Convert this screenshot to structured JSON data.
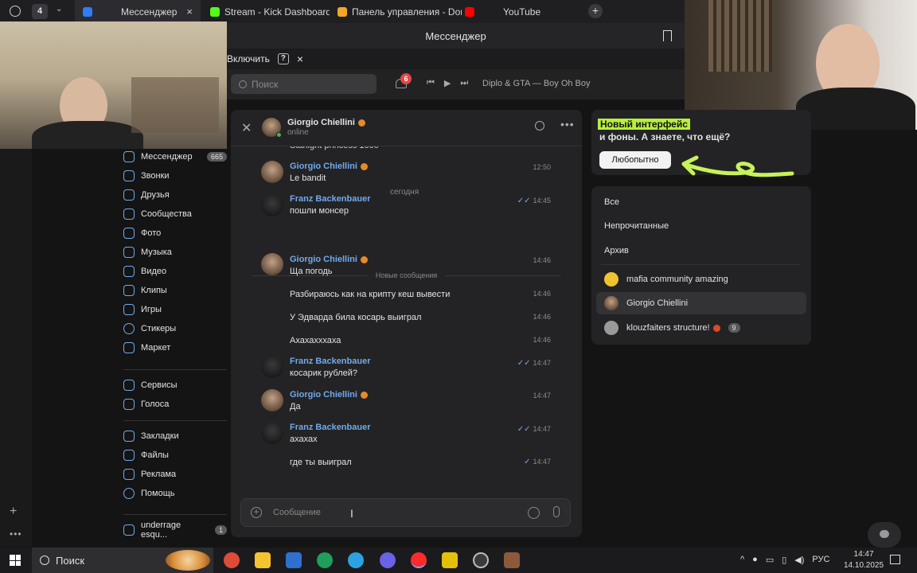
{
  "browser": {
    "tab_count": "4",
    "tabs": [
      {
        "label": "Мессенджер",
        "color": "#2f7cf6"
      },
      {
        "label": "Stream - Kick Dashboard",
        "color": "#53fc18"
      },
      {
        "label": "Панель управления - Don",
        "color": "#f5a623"
      },
      {
        "label": "YouTube",
        "color": "#ff0000"
      }
    ],
    "title": "Мессенджер",
    "infobar_enable": "Включить",
    "infobar_help": "?",
    "infobar_close": "×"
  },
  "vk_header": {
    "search_placeholder": "Поиск",
    "notifications_count": "6",
    "track": "Diplo & GTA — Boy Oh Boy"
  },
  "nav": {
    "items": [
      {
        "label": "Мессенджер",
        "count": "665"
      },
      {
        "label": "Звонки"
      },
      {
        "label": "Друзья"
      },
      {
        "label": "Сообщества"
      },
      {
        "label": "Фото"
      },
      {
        "label": "Музыка"
      },
      {
        "label": "Видео"
      },
      {
        "label": "Клипы"
      },
      {
        "label": "Игры"
      },
      {
        "label": "Стикеры"
      },
      {
        "label": "Маркет"
      }
    ],
    "services": [
      {
        "label": "Сервисы"
      },
      {
        "label": "Голоса"
      }
    ],
    "extras": [
      {
        "label": "Закладки"
      },
      {
        "label": "Файлы"
      },
      {
        "label": "Реклама"
      },
      {
        "label": "Помощь"
      }
    ],
    "group": {
      "label": "underrage esqu...",
      "count": "1"
    }
  },
  "chat": {
    "peer_name": "Giorgio Chiellini",
    "peer_status": "online",
    "cut_text": "Starlight princess 1000",
    "date_divider": "сегодня",
    "new_divider": "Новые сообщения",
    "messages": [
      {
        "name": "Giorgio Chiellini",
        "text": "Le bandit",
        "time": "12:50"
      },
      {
        "name": "Franz Backenbauer",
        "text": "пошли монсер",
        "time": "14:45",
        "read": true
      },
      {
        "name": "Giorgio Chiellini",
        "text": "Ща погодь",
        "time": "14:46"
      },
      {
        "text": "Разбираюсь как на крипту кеш вывести",
        "time": "14:46"
      },
      {
        "text": "У Эдварда била косарь выиграл",
        "time": "14:46"
      },
      {
        "text": "Ахахахххаха",
        "time": "14:46"
      },
      {
        "name": "Franz Backenbauer",
        "text": "косарик рублей?",
        "time": "14:47",
        "read": true
      },
      {
        "name": "Giorgio Chiellini",
        "text": "Да",
        "time": "14:47"
      },
      {
        "name": "Franz Backenbauer",
        "text": "ахахах",
        "time": "14:47",
        "read": true
      },
      {
        "text": "где ты выиграл",
        "time": "14:47",
        "read": true
      }
    ],
    "composer_placeholder": "Сообщение"
  },
  "promo": {
    "highlight": "Новый интерфейс",
    "text": "и фоны. А знаете, что ещё?",
    "button": "Любопытно"
  },
  "filters": {
    "all": "Все",
    "unread": "Непрочитанные",
    "archive": "Архив"
  },
  "conversations": [
    {
      "name": "mafia community amazing",
      "avatar": "yellow"
    },
    {
      "name": "Giorgio Chiellini",
      "avatar": "face",
      "selected": true
    },
    {
      "name": "klouzfaiters structure!",
      "avatar": "grey",
      "count": "9"
    }
  ],
  "taskbar": {
    "search": "Поиск",
    "apps": [
      {
        "name": "chrome",
        "color": "#dd4b39"
      },
      {
        "name": "explorer",
        "color": "#f4c430"
      },
      {
        "name": "store",
        "color": "#2f6fd0"
      },
      {
        "name": "browser-green",
        "color": "#1f9f5a"
      },
      {
        "name": "telegram",
        "color": "#2aa3e0"
      },
      {
        "name": "discord",
        "color": "#6b61e6"
      },
      {
        "name": "yandex",
        "color": "#ff2a2a"
      },
      {
        "name": "app-yellow",
        "color": "#e3c10a"
      },
      {
        "name": "obs",
        "color": "#3a3a3a"
      },
      {
        "name": "game",
        "color": "#8a5a3a"
      }
    ],
    "lang": "РУС",
    "time": "14:47",
    "date": "14.10.2025"
  }
}
